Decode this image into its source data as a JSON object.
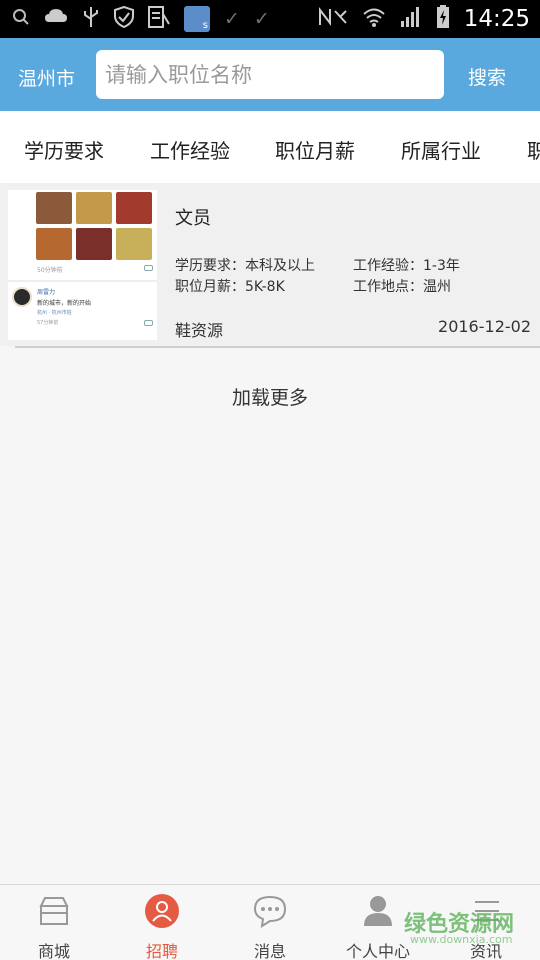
{
  "status_bar": {
    "time": "14:25",
    "left_icons": [
      "search-icon",
      "cloud-icon",
      "usb-icon",
      "shield-icon",
      "news-icon",
      "app-icon",
      "check-icon",
      "check-icon"
    ],
    "right_icons": [
      "nfc-icon",
      "wifi-icon",
      "signal-icon",
      "battery-icon"
    ]
  },
  "header": {
    "city": "温州市",
    "search_placeholder": "请输入职位名称",
    "search_button": "搜索"
  },
  "filters": [
    "学历要求",
    "工作经验",
    "职位月薪",
    "所属行业",
    "职"
  ],
  "jobs": [
    {
      "title": "文员",
      "education_label": "学历要求：",
      "education": "本科及以上",
      "experience_label": "工作经验：",
      "experience": "1-3年",
      "salary_label": "职位月薪：",
      "salary": "5K-8K",
      "location_label": "工作地点：",
      "location": "温州",
      "company": "鞋资源",
      "date": "2016-12-02",
      "thumbnail": {
        "time1": "50分钟前",
        "user": "周雷力",
        "text": "新的城市，新的开始",
        "loc": "杭州 · 杭州市桩",
        "time2": "57分钟前"
      }
    }
  ],
  "load_more": "加载更多",
  "bottom_nav": [
    {
      "label": "商城",
      "icon": "store-icon",
      "active": false
    },
    {
      "label": "招聘",
      "icon": "recruit-icon",
      "active": true
    },
    {
      "label": "消息",
      "icon": "message-icon",
      "active": false
    },
    {
      "label": "个人中心",
      "icon": "person-icon",
      "active": false
    },
    {
      "label": "资讯",
      "icon": "news-list-icon",
      "active": false
    }
  ],
  "watermark": {
    "text": "绿色资源网",
    "url": "www.downxia.com"
  },
  "colors": {
    "header_bg": "#59a9df",
    "active_nav": "#e55a43",
    "watermark": "#5cb25a"
  }
}
